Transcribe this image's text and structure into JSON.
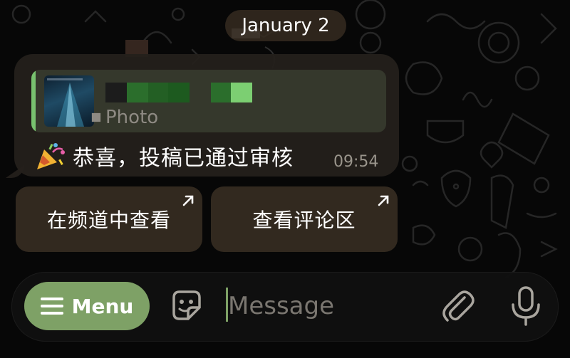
{
  "chat": {
    "date_label": "January 2",
    "message": {
      "reply_preview": {
        "subtitle": "Photo",
        "icon": "photo-icon"
      },
      "emoji_icon": "party-popper-icon",
      "text": "恭喜，投稿已通过审核",
      "time": "09:54"
    },
    "inline_buttons": [
      {
        "label": "在频道中查看",
        "icon": "external-arrow-icon"
      },
      {
        "label": "查看评论区",
        "icon": "external-arrow-icon"
      }
    ]
  },
  "composer": {
    "menu_label": "Menu",
    "menu_icon": "hamburger-icon",
    "sticker_icon": "sticker-icon",
    "placeholder": "Message",
    "value": "",
    "attach_icon": "paperclip-icon",
    "mic_icon": "microphone-icon"
  },
  "colors": {
    "accent": "#7ea166",
    "reply_bar": "#78c26f",
    "bubble": "#24201c",
    "background": "#070707"
  }
}
